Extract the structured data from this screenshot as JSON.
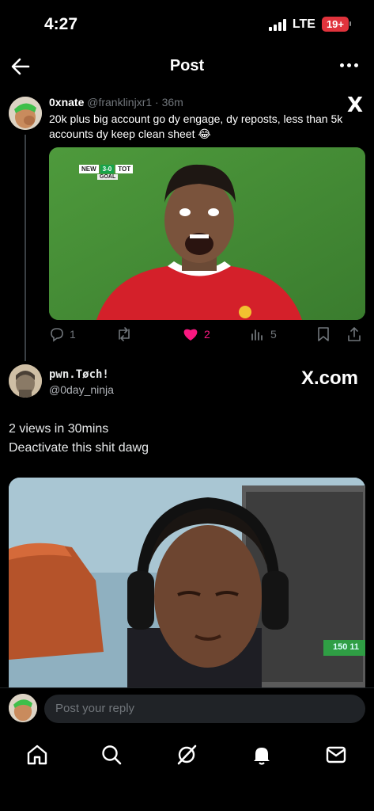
{
  "status_bar": {
    "time": "4:27",
    "network": "LTE",
    "battery": "19+"
  },
  "header": {
    "title": "Post",
    "back_icon": "back-arrow-icon",
    "more_icon": "more-dots-icon"
  },
  "quoted_tweet": {
    "name": "0xnate",
    "handle": "@franklinjxr1",
    "separator": " · ",
    "time": "36m",
    "text": "20k plus big account go dy engage, dy reposts, less than 5k accounts dy keep clean sheet 😂",
    "platform_logo": "X",
    "media_scoreboard": {
      "home": "NEW",
      "score": "3-0",
      "away": "TOT",
      "label": "GOAL"
    },
    "metrics": {
      "replies": "1",
      "reposts": "",
      "likes": "2",
      "views": "5"
    },
    "colors": {
      "like": "#f91880",
      "muted": "#71767b"
    }
  },
  "main_tweet": {
    "name": "pwn.Tøch!",
    "handle": "@0day_ninja",
    "watermark": "X.com",
    "text_line1": "2 views in 30mins",
    "text_line2": "Deactivate this shit dawg",
    "media_overlay_text": "150 11"
  },
  "reply": {
    "placeholder": "Post your reply"
  },
  "bottom_nav": {
    "items": [
      "home-icon",
      "search-icon",
      "grok-icon",
      "notifications-icon",
      "messages-icon"
    ]
  }
}
